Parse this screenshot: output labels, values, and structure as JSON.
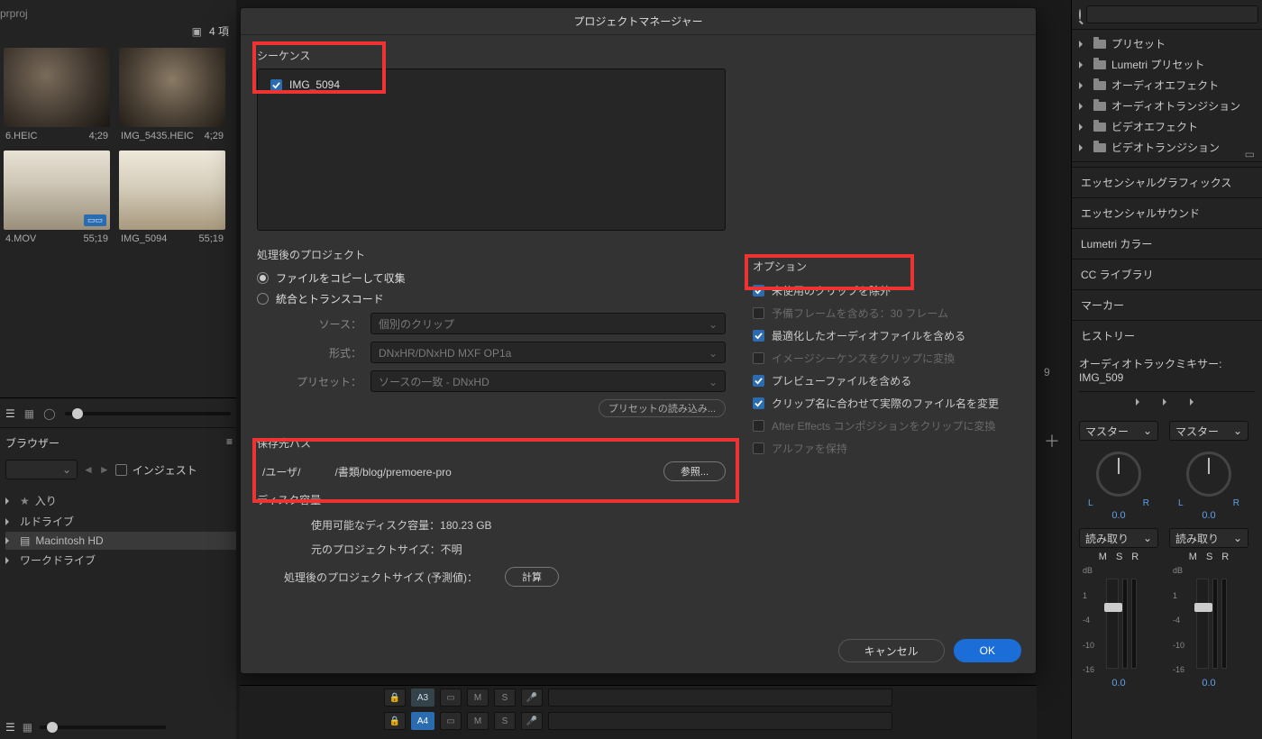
{
  "project_ext": "prproj",
  "project_bar": {
    "count": "4 項"
  },
  "thumbs": [
    {
      "name": "6.HEIC",
      "dur": "4;29"
    },
    {
      "name": "IMG_5435.HEIC",
      "dur": "4;29"
    },
    {
      "name": "4.MOV",
      "dur": "55;19"
    },
    {
      "name": "IMG_5094",
      "dur": "55;19"
    }
  ],
  "browser": {
    "title": "ブラウザー",
    "ingest": "インジェスト",
    "tree": [
      "入り",
      "ルドライブ",
      "Macintosh HD",
      "ワークドライブ"
    ]
  },
  "dialog": {
    "title": "プロジェクトマネージャー",
    "sequence_label": "シーケンス",
    "sequence_item": "IMG_5094",
    "result_project_label": "処理後のプロジェクト",
    "radio_copy": "ファイルをコピーして収集",
    "radio_transcode": "統合とトランスコード",
    "source_label": "ソース：",
    "source_value": "個別のクリップ",
    "format_label": "形式：",
    "format_value": "DNxHR/DNxHD MXF OP1a",
    "preset_label": "プリセット：",
    "preset_value": "ソースの一致 - DNxHD",
    "preset_load": "プリセットの読み込み...",
    "destpath_label": "保存先パス",
    "destpath_user": "/ユーザ/",
    "destpath_rest": "/書類/blog/premoere-pro",
    "browse": "参照...",
    "disk_label": "ディスク容量",
    "disk_avail_label": "使用可能なディスク容量：",
    "disk_avail_val": "180.23 GB",
    "orig_size_label": "元のプロジェクトサイズ：",
    "orig_size_val": "不明",
    "after_size_label": "処理後のプロジェクトサイズ (予測値)：",
    "calc": "計算",
    "options_label": "オプション",
    "opts": {
      "exclude_unused": "未使用のクリップを除外",
      "include_handles": "予備フレームを含める：30 フレーム",
      "opt_audio": "最適化したオーディオファイルを含める",
      "img_seq": "イメージシーケンスをクリップに変換",
      "preview": "プレビューファイルを含める",
      "rename": "クリップ名に合わせて実際のファイル名を変更",
      "ae_comp": "After Effects コンポジションをクリップに変換",
      "alpha": "アルファを保持"
    },
    "cancel": "キャンセル",
    "ok": "OK"
  },
  "right": {
    "presets": [
      "プリセット",
      "Lumetri プリセット",
      "オーディオエフェクト",
      "オーディオトランジション",
      "ビデオエフェクト",
      "ビデオトランジション"
    ],
    "panels": [
      "エッセンシャルグラフィックス",
      "エッセンシャルサウンド",
      "Lumetri カラー",
      "CC ライブラリ",
      "マーカー",
      "ヒストリー"
    ],
    "mixer_title": "オーディオトラックミキサー: IMG_509",
    "track": {
      "dest": "マスター",
      "lrL": "L",
      "lrR": "R",
      "pan": "0.0",
      "read": "読み取り",
      "msr": [
        "M",
        "S",
        "R"
      ],
      "db": [
        "dB",
        "1",
        "-4",
        "-10",
        "-16"
      ],
      "bottom": "0.0"
    }
  },
  "timeline": {
    "a3": "A3",
    "a4": "A4",
    "m": "M",
    "s": "S"
  },
  "misc": {
    "nine": "9"
  }
}
